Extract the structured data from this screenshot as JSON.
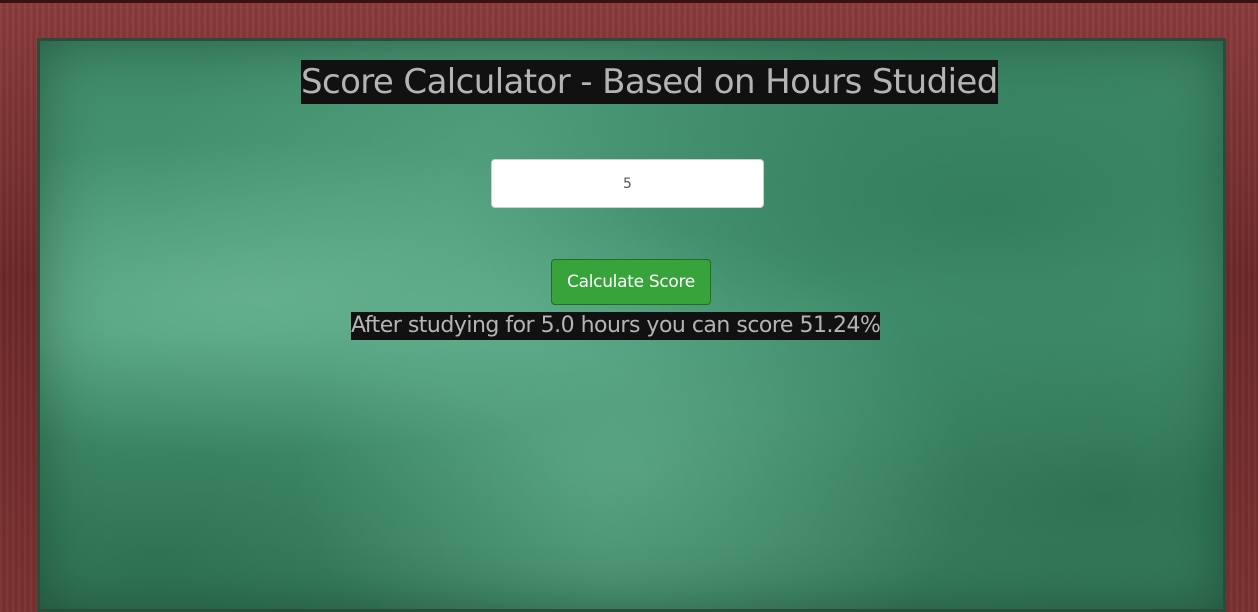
{
  "page": {
    "title": "Score Calculator - Based on Hours Studied"
  },
  "form": {
    "hours_value": "5",
    "button_label": "Calculate Score"
  },
  "result": {
    "text": "After studying for 5.0 hours you can score 51.24%"
  },
  "colors": {
    "board": "#4a9a76",
    "frame": "#7a3030",
    "button": "#37a33a",
    "text_highlight_bg": "#111111",
    "text": "#b4b4b4"
  }
}
